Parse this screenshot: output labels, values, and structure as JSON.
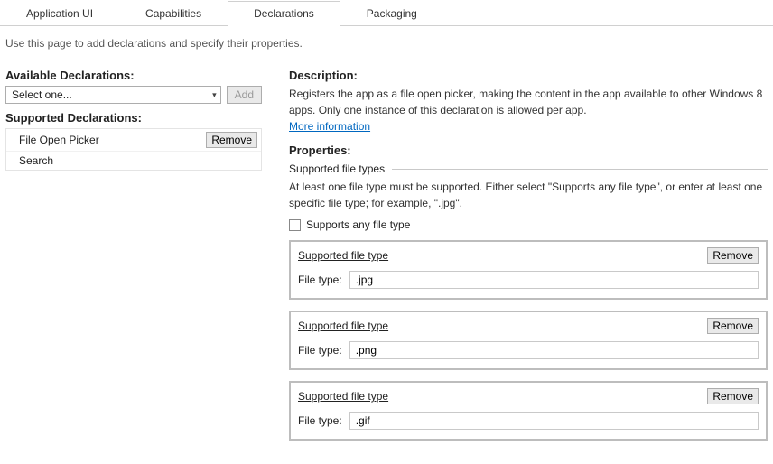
{
  "tabs": {
    "items": [
      {
        "label": "Application UI"
      },
      {
        "label": "Capabilities"
      },
      {
        "label": "Declarations"
      },
      {
        "label": "Packaging"
      }
    ],
    "active_index": 2
  },
  "page_hint": "Use this page to add declarations and specify their properties.",
  "left": {
    "available_heading": "Available Declarations:",
    "select_placeholder": "Select one...",
    "add_label": "Add",
    "supported_heading": "Supported Declarations:",
    "declarations": [
      {
        "label": "File Open Picker",
        "remove": "Remove",
        "selected": true
      },
      {
        "label": "Search",
        "remove": "",
        "selected": false
      }
    ]
  },
  "right": {
    "description_heading": "Description:",
    "description_text": "Registers the app as a file open picker, making the content in the app available to other Windows 8 apps. Only one instance of this declaration is allowed per app.",
    "more_info": "More information",
    "properties_heading": "Properties:",
    "section_title": "Supported file types",
    "section_help": "At least one file type must be supported. Either select \"Supports any file type\", or enter at least one specific file type; for example, \".jpg\".",
    "supports_any_label": "Supports any file type",
    "file_type_block_title": "Supported file type",
    "file_type_row_label": "File type:",
    "remove_label": "Remove",
    "file_types": [
      {
        "value": ".jpg"
      },
      {
        "value": ".png"
      },
      {
        "value": ".gif"
      }
    ]
  }
}
